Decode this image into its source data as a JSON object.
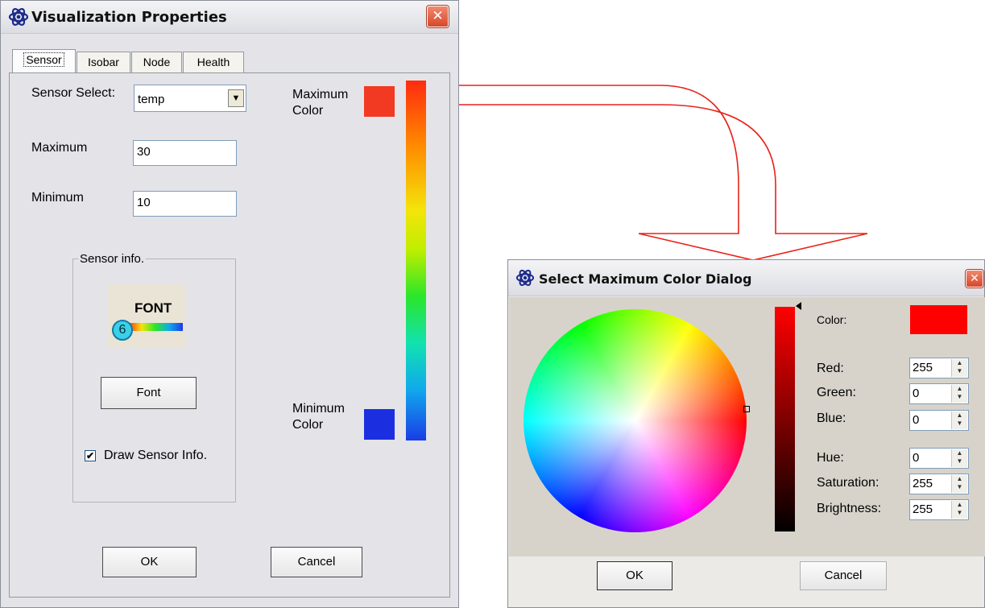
{
  "vis_dialog": {
    "title": "Visualization Properties",
    "close_glyph": "✕",
    "tabs": [
      "Sensor",
      "Isobar",
      "Node",
      "Health"
    ],
    "active_tab": "Sensor",
    "sensor_select_label": "Sensor Select:",
    "sensor_select_value": "temp",
    "maximum_label": "Maximum",
    "maximum_value": "30",
    "minimum_label": "Minimum",
    "minimum_value": "10",
    "max_color_label_1": "Maximum",
    "max_color_label_2": "Color",
    "min_color_label_1": "Minimum",
    "min_color_label_2": "Color",
    "max_color": "#f23a22",
    "min_color": "#1b2fe0",
    "group_title": "Sensor info.",
    "font_preview_text": "FONT",
    "font_preview_number": "6",
    "font_button": "Font",
    "draw_sensor_info_label": "Draw Sensor Info.",
    "draw_sensor_info_checked": true,
    "ok_label": "OK",
    "cancel_label": "Cancel"
  },
  "color_dialog": {
    "title": "Select Maximum Color Dialog",
    "close_glyph": "✕",
    "color_label": "Color:",
    "current_color": "#ff0000",
    "fields": [
      {
        "label": "Red:",
        "value": "255"
      },
      {
        "label": "Green:",
        "value": "0"
      },
      {
        "label": "Blue:",
        "value": "0"
      },
      {
        "label": "Hue:",
        "value": "0"
      },
      {
        "label": "Saturation:",
        "value": "255"
      },
      {
        "label": "Brightness:",
        "value": "255"
      }
    ],
    "ok_label": "OK",
    "cancel_label": "Cancel"
  },
  "icons": {
    "app": "atom-icon",
    "dropdown": "chevron-down-icon",
    "spinner": "spinner-arrows-icon",
    "checkbox_glyph": "✔"
  }
}
